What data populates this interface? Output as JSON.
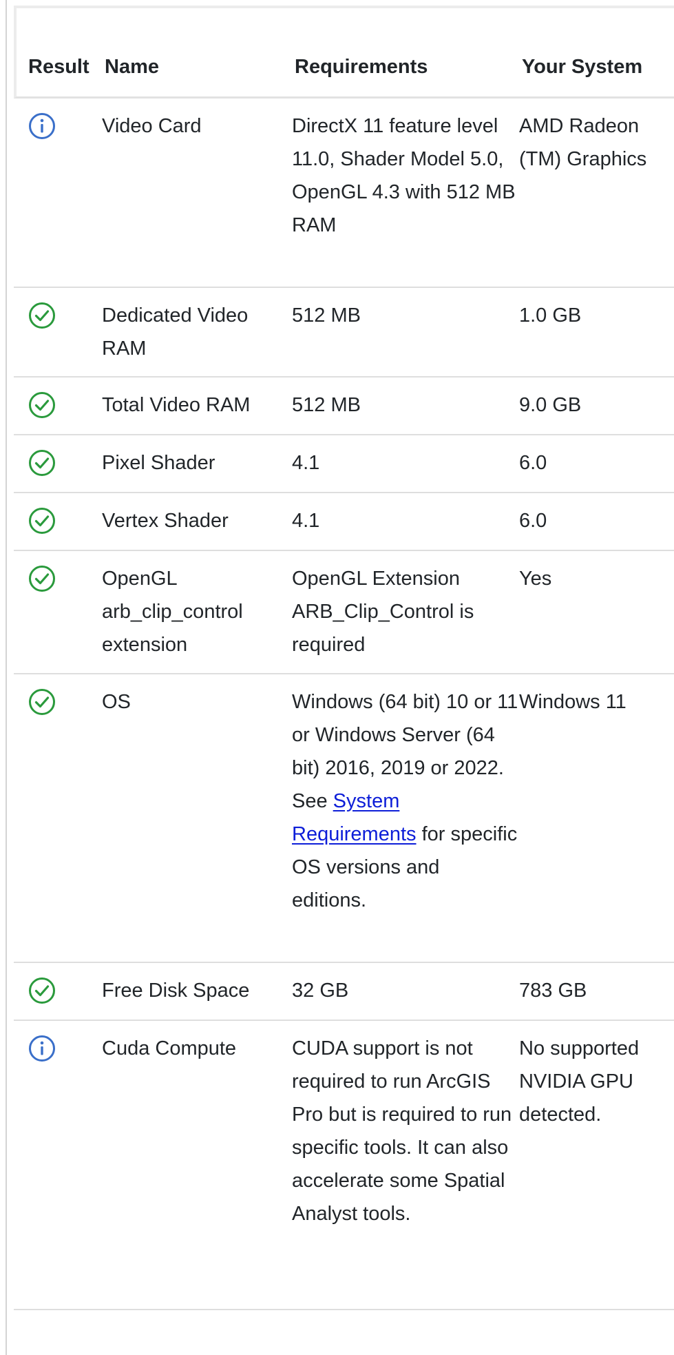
{
  "table": {
    "headers": {
      "result": "Result",
      "name": "Name",
      "requirements": "Requirements",
      "your_system": "Your System"
    },
    "rows": [
      {
        "status": "info",
        "name": "Video Card",
        "requirements": "DirectX 11 feature level 11.0, Shader Model 5.0, OpenGL 4.3 with 512 MB RAM",
        "your_system": "AMD Radeon (TM) Graphics"
      },
      {
        "status": "pass",
        "name": "Dedicated Video RAM",
        "requirements": "512 MB",
        "your_system": "1.0 GB"
      },
      {
        "status": "pass",
        "name": "Total Video RAM",
        "requirements": "512 MB",
        "your_system": "9.0 GB"
      },
      {
        "status": "pass",
        "name": "Pixel Shader",
        "requirements": "4.1",
        "your_system": "6.0"
      },
      {
        "status": "pass",
        "name": "Vertex Shader",
        "requirements": "4.1",
        "your_system": "6.0"
      },
      {
        "status": "pass",
        "name": "OpenGL arb_clip_control extension",
        "requirements": "OpenGL Extension ARB_Clip_Control is required",
        "your_system": "Yes"
      },
      {
        "status": "pass",
        "name": "OS",
        "requirements_before_link": "Windows (64 bit) 10 or 11 or Windows Server (64 bit) 2016, 2019 or 2022. See",
        "requirements_link": "System Requirements",
        "requirements_after_link": "for specific OS versions and editions.",
        "your_system": "Windows 11"
      },
      {
        "status": "pass",
        "name": "Free Disk Space",
        "requirements": "32 GB",
        "your_system": "783 GB"
      },
      {
        "status": "info",
        "name": "Cuda Compute",
        "requirements": "CUDA support is not required to run ArcGIS Pro but is required to run specific tools. It can also accelerate some Spatial Analyst tools.",
        "your_system": "No supported NVIDIA GPU detected."
      }
    ]
  },
  "colors": {
    "pass": "#2a9a3c",
    "info": "#3a6fc9",
    "link": "#0d1ed8"
  },
  "icons": {
    "pass": "check-circle-icon",
    "info": "info-circle-icon"
  }
}
